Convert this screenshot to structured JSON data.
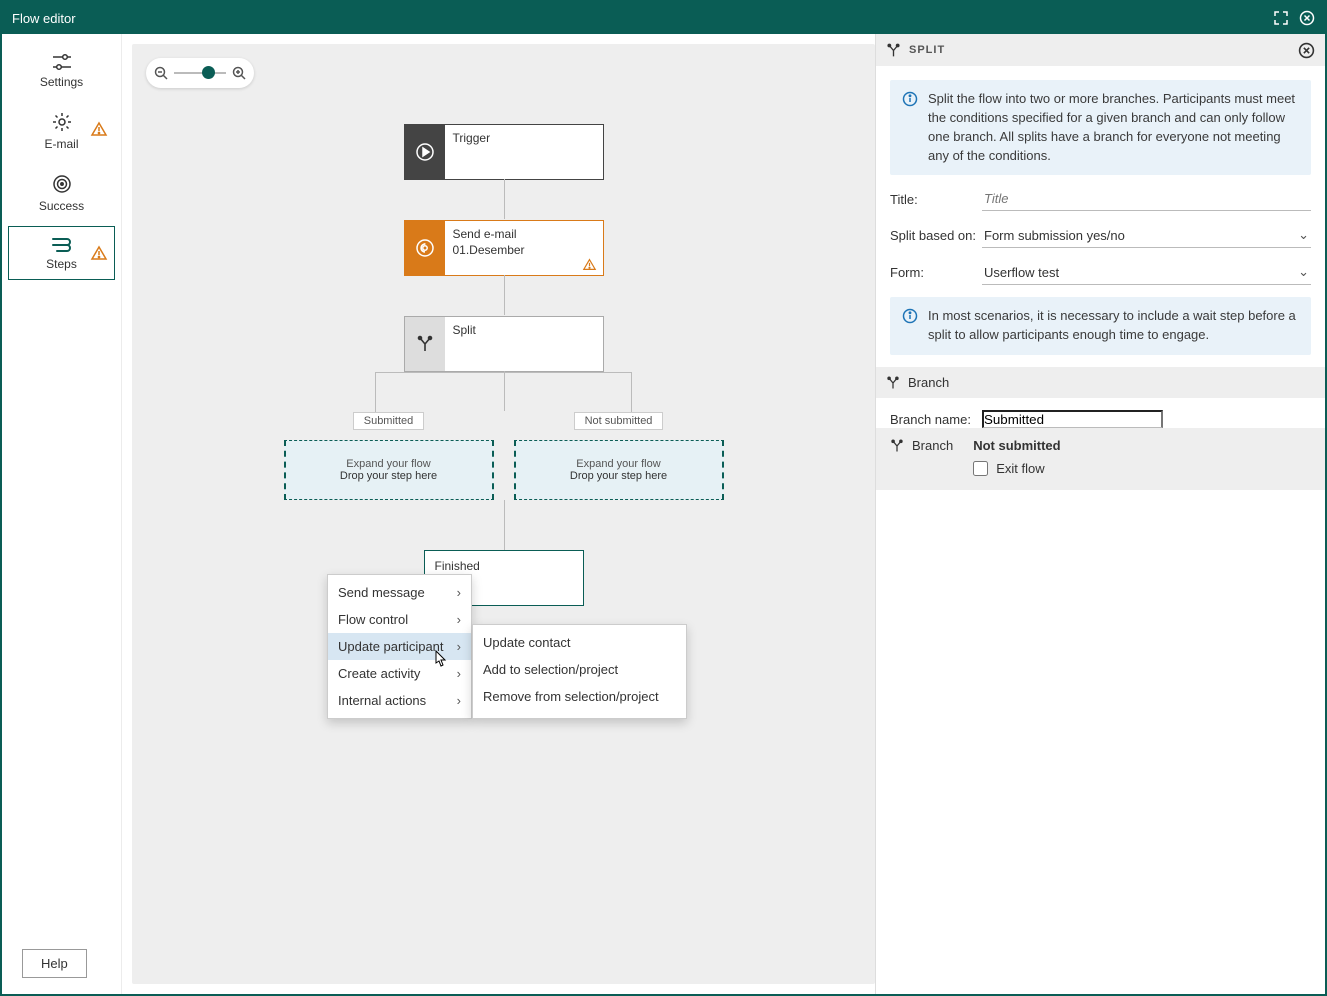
{
  "header": {
    "title": "Flow editor"
  },
  "sidebar": {
    "items": [
      {
        "label": "Settings",
        "icon": "sliders-icon",
        "warn": false
      },
      {
        "label": "E-mail",
        "icon": "gear-icon",
        "warn": true
      },
      {
        "label": "Success",
        "icon": "target-icon",
        "warn": false
      },
      {
        "label": "Steps",
        "icon": "steps-icon",
        "warn": true
      }
    ],
    "help_label": "Help"
  },
  "canvas": {
    "nodes": {
      "trigger": {
        "title": "Trigger"
      },
      "email": {
        "title": "Send e-mail",
        "subtitle": "01.Desember"
      },
      "split": {
        "title": "Split"
      },
      "finished": {
        "title": "Finished"
      }
    },
    "branches": {
      "left_label": "Submitted",
      "right_label": "Not submitted",
      "zone_line1": "Expand your flow",
      "zone_line2": "Drop your step here"
    },
    "context_menu": {
      "items": [
        "Send message",
        "Flow control",
        "Update participant",
        "Create activity",
        "Internal actions"
      ],
      "sub_items": [
        "Update contact",
        "Add to selection/project",
        "Remove from selection/project"
      ],
      "hovered_index": 2
    }
  },
  "panel": {
    "title": "SPLIT",
    "info1": "Split the flow into two or more branches. Participants must meet the conditions specified for a given branch and can only follow one branch. All splits have a branch for everyone not meeting any of the conditions.",
    "title_label": "Title:",
    "title_placeholder": "Title",
    "split_label": "Split based on:",
    "split_value": "Form submission yes/no",
    "form_label": "Form:",
    "form_value": "Userflow test",
    "info2": "In most scenarios, it is necessary to include a wait step before a split to allow participants enough time to engage.",
    "branch_header": "Branch",
    "branch_name_label": "Branch name:",
    "branch_name_value": "Submitted",
    "branch2_header": "Branch",
    "branch2_name": "Not submitted",
    "exit_flow_label": "Exit flow"
  }
}
